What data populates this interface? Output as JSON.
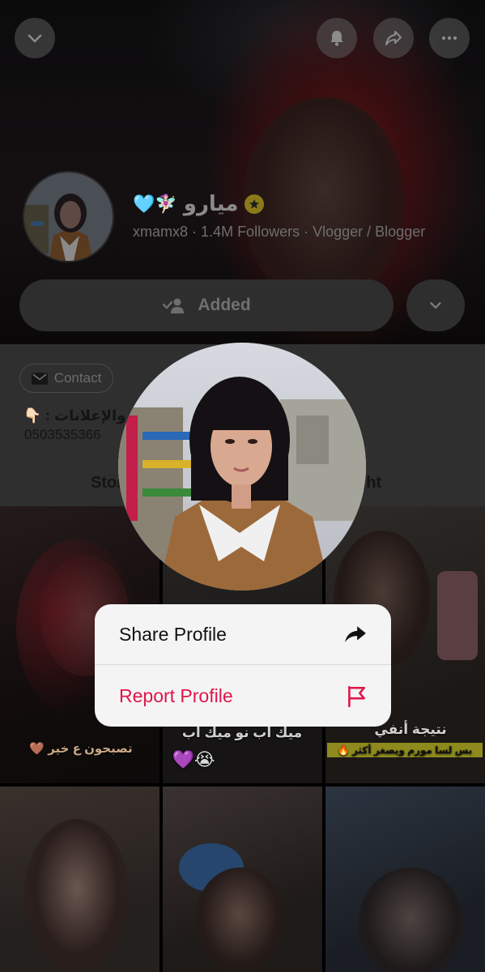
{
  "header": {
    "profile_name": "ميارو",
    "name_emojis": "🩵🧚🏻‍♀️",
    "username": "xmamx8",
    "followers": "1.4M Followers",
    "category": "Vlogger / Blogger",
    "separator": "·",
    "icons": [
      "chevron-down-icon",
      "bell-icon",
      "share-arrow-icon",
      "more-icon",
      "star-badge-icon"
    ]
  },
  "actions": {
    "added_label": "Added"
  },
  "info": {
    "contact_label": "Contact",
    "bio_text": "ل والإعلانات : 👇🏻",
    "phone": "0503535366",
    "tab_left": "Stor",
    "tab_right": "ght"
  },
  "grid": {
    "captions": [
      "تصبحون ع خير 🤎",
      "ميك أب نو ميك أب",
      "😭💜",
      "نتيجة أنفي",
      "بس لسا مورم ويصغر أكثر 🔥"
    ]
  },
  "menu": {
    "share_label": "Share Profile",
    "report_label": "Report Profile"
  },
  "colors": {
    "report": "#e0164a",
    "menu_bg": "#f4f4f4",
    "button_bg": "#2e2e2e"
  }
}
